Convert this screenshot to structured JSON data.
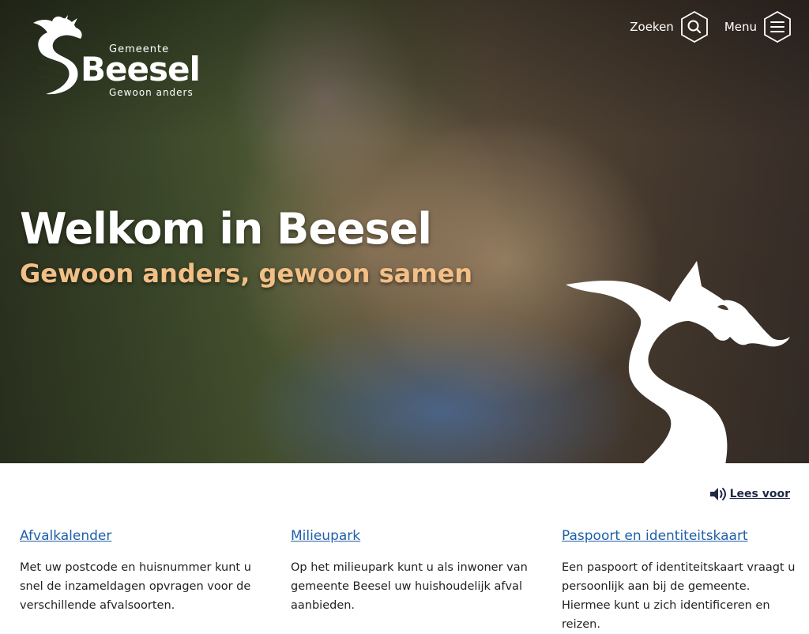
{
  "header": {
    "logo": {
      "prefix": "Gemeente",
      "name": "Beesel",
      "tagline": "Gewoon anders"
    },
    "nav": {
      "search_label": "Zoeken",
      "search_icon": "search-icon",
      "menu_label": "Menu",
      "menu_icon": "hamburger-icon"
    }
  },
  "hero": {
    "title": "Welkom in Beesel",
    "subtitle": "Gewoon anders, gewoon samen",
    "subtitle_color": "#f2bf86"
  },
  "content": {
    "read_aloud_label": "Lees voor",
    "read_aloud_icon": "speaker-icon",
    "cards": [
      {
        "title": "Afvalkalender",
        "text": "Met uw postcode en huisnummer kunt u snel de inzameldagen opvragen voor de verschillende afvalsoorten."
      },
      {
        "title": "Milieupark",
        "text": "Op het milieupark kunt u als inwoner van gemeente Beesel uw huishoudelijk afval aanbieden."
      },
      {
        "title": "Paspoort en identiteitskaart",
        "text": "Een paspoort of identiteitskaart vraagt u persoonlijk aan bij de gemeente. Hiermee kunt u zich identificeren en reizen."
      }
    ]
  },
  "colors": {
    "link": "#1f5fa8",
    "heading_text": "#ffffff"
  }
}
